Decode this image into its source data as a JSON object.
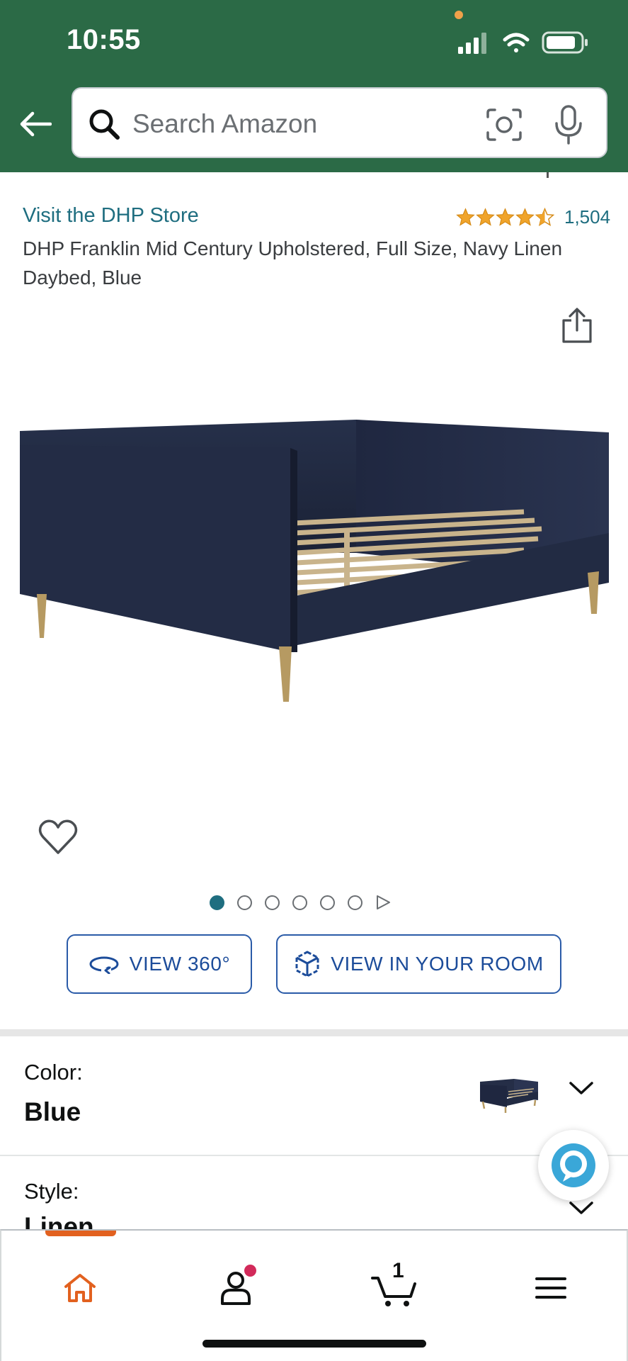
{
  "status_bar": {
    "time": "10:55"
  },
  "search": {
    "placeholder": "Search Amazon"
  },
  "product": {
    "store_link": "Visit the DHP Store",
    "rating_stars": 4.5,
    "rating_count": "1,504",
    "title": "DHP Franklin Mid Century Upholstered, Full Size, Navy Linen Daybed, Blue",
    "image_count": 6,
    "active_image_index": 0
  },
  "buttons": {
    "view_360": "VIEW 360°",
    "view_room": "VIEW IN YOUR ROOM"
  },
  "options": {
    "color_label": "Color:",
    "color_value": "Blue",
    "style_label": "Style:",
    "style_value": "Linen"
  },
  "nav": {
    "cart_count": "1",
    "items": [
      "home",
      "account",
      "cart",
      "menu"
    ]
  },
  "colors": {
    "header_bg": "#2b6a46",
    "link": "#1f6e80",
    "star": "#f0a42b",
    "button_border": "#2a5ba8",
    "nav_active": "#e2611f"
  }
}
